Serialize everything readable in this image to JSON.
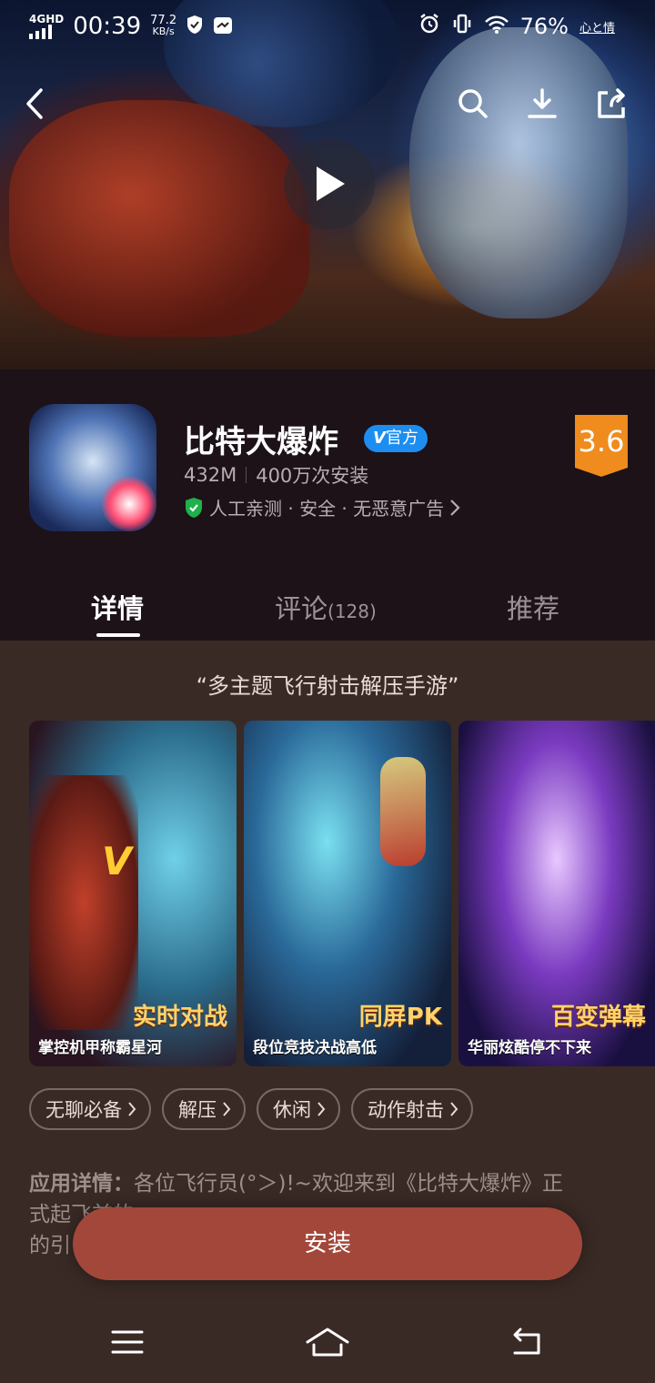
{
  "status_bar": {
    "network": "4GHD",
    "time": "00:39",
    "speed_value": "77.2",
    "speed_unit": "KB/s",
    "battery": "76%",
    "carrier_tag": "心と情"
  },
  "app": {
    "name": "比特大爆炸",
    "official_badge": "官方",
    "size": "432M",
    "installs": "400万次安装",
    "safety": "人工亲测 · 安全 · 无恶意广告",
    "rating": "3.6"
  },
  "tabs": [
    {
      "label": "详情",
      "count": ""
    },
    {
      "label": "评论",
      "count": "(128)"
    },
    {
      "label": "推荐",
      "count": ""
    }
  ],
  "slogan": "“多主题飞行射击解压手游”",
  "screenshots": [
    {
      "caption_big": "实时对战",
      "caption_small": "掌控机甲称霸星河"
    },
    {
      "caption_big": "同屏PK",
      "caption_small": "段位竞技决战高低"
    },
    {
      "caption_big": "百变弹幕",
      "caption_small": "华丽炫酷停不下来"
    }
  ],
  "tags": [
    "无聊必备",
    "解压",
    "休闲",
    "动作射击"
  ],
  "description": {
    "label": "应用详情：",
    "line1": "各位飞行员(°＞)!~欢迎来到《比特大爆炸》正",
    "line2": "式起飞前的...",
    "line3": "的引"
  },
  "install_button": "安装"
}
